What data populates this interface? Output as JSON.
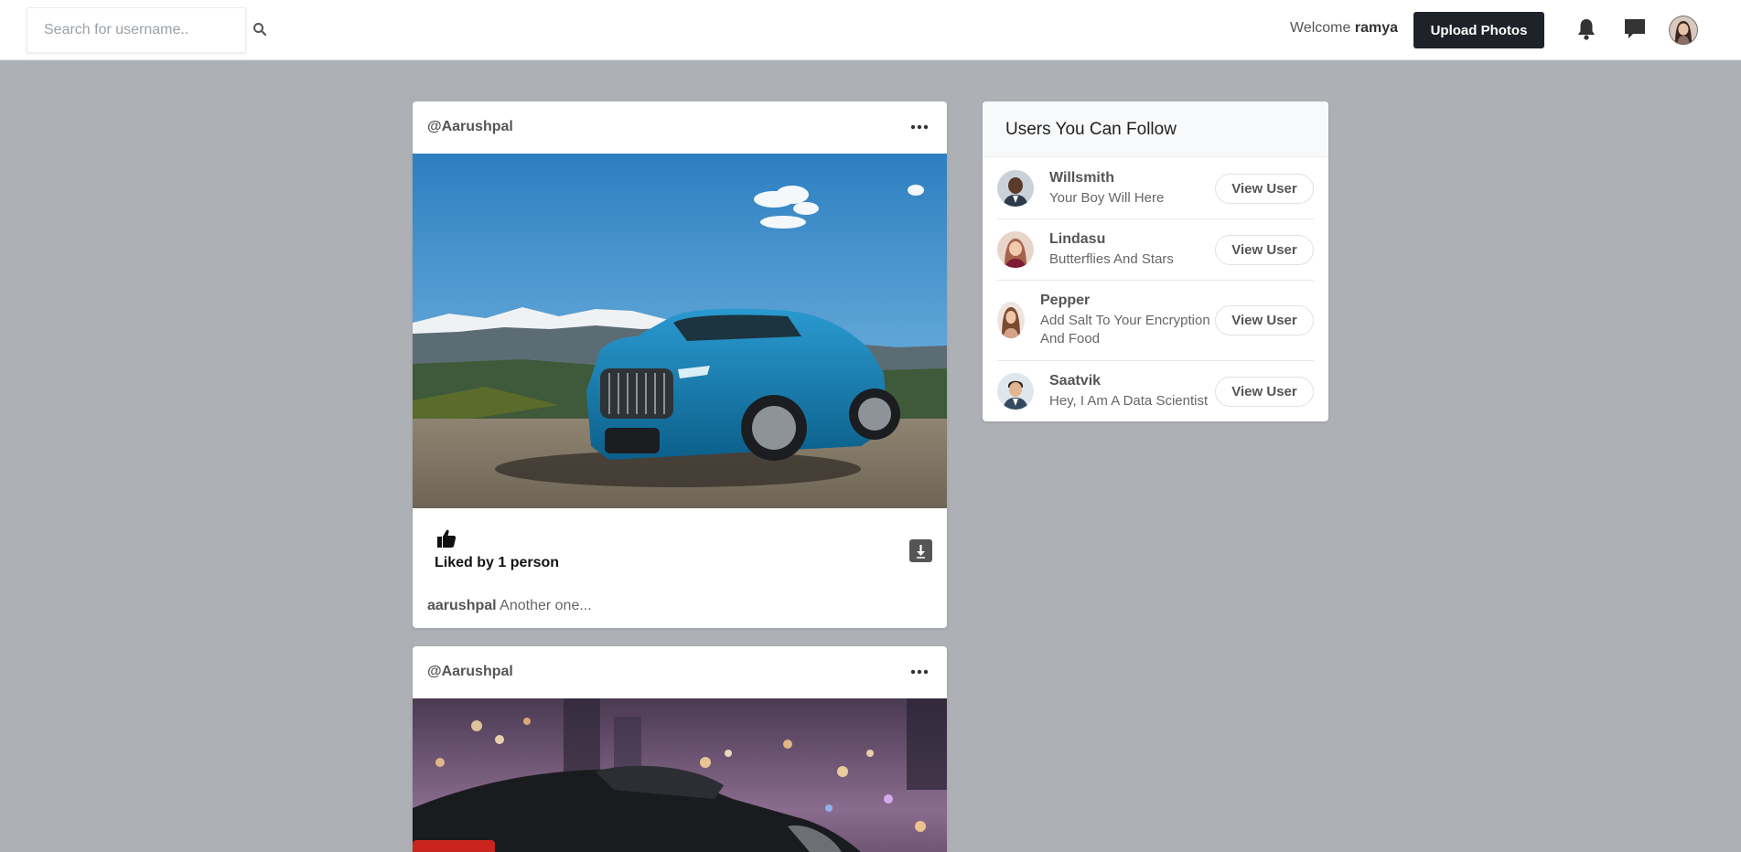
{
  "navbar": {
    "search_placeholder": "Search for username..",
    "welcome_prefix": "Welcome",
    "welcome_user": "ramya",
    "upload_label": "Upload Photos",
    "icons": [
      "search-icon",
      "bell-icon",
      "chat-icon",
      "avatar"
    ]
  },
  "posts": [
    {
      "username": "@Aarushpal",
      "image": "blue suv on mountain overlook",
      "liked_by": "Liked by 1 person",
      "caption_user": "aarushpal",
      "caption_text": "Another one..."
    },
    {
      "username": "@Aarushpal",
      "image": "dark car with city bokeh lights"
    }
  ],
  "follow": {
    "title": "Users You Can Follow",
    "button_label": "View User",
    "users": [
      {
        "name": "Willsmith",
        "bio": "Your Boy Will Here"
      },
      {
        "name": "Lindasu",
        "bio": "Butterflies And Stars"
      },
      {
        "name": "Pepper",
        "bio": "Add Salt To Your Encryption And Food"
      },
      {
        "name": "Saatvik",
        "bio": "Hey, I Am A Data Scientist"
      }
    ]
  },
  "colors": {
    "background": "#adb0b5",
    "upload_button": "#1f2228",
    "card": "#ffffff"
  }
}
